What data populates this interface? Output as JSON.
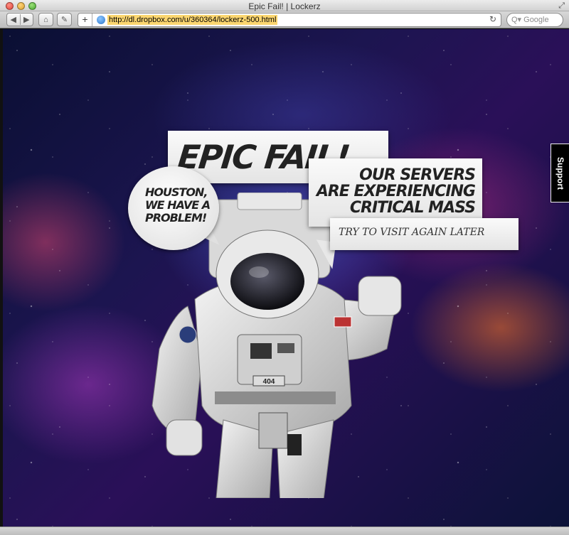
{
  "window": {
    "title": "Epic Fail! | Lockerz"
  },
  "toolbar": {
    "back_glyph": "◀",
    "forward_glyph": "▶",
    "home_glyph": "⌂",
    "reader_glyph": "✎",
    "add_glyph": "+",
    "url": "http://dl.dropbox.com/u/360364/lockerz-500.html",
    "reload_glyph": "↻",
    "search_placeholder": "Q▾ Google",
    "fullscreen_glyph": "⤢"
  },
  "page": {
    "headline": "EPIC FAIL!",
    "servers_line1": "OUR SERVERS",
    "servers_line2": "ARE EXPERIENCING",
    "servers_line3": "CRITICAL MASS",
    "visit_text": "TRY TO VISIT AGAIN LATER",
    "houston_line1": "HOUSTON,",
    "houston_line2": "WE HAVE A",
    "houston_line3": "PROBLEM!",
    "badge_code": "404",
    "support_label": "Support"
  },
  "colors": {
    "url_highlight": "#fbd670",
    "bubble": "#f0f0f0",
    "text_dark": "#222222"
  }
}
